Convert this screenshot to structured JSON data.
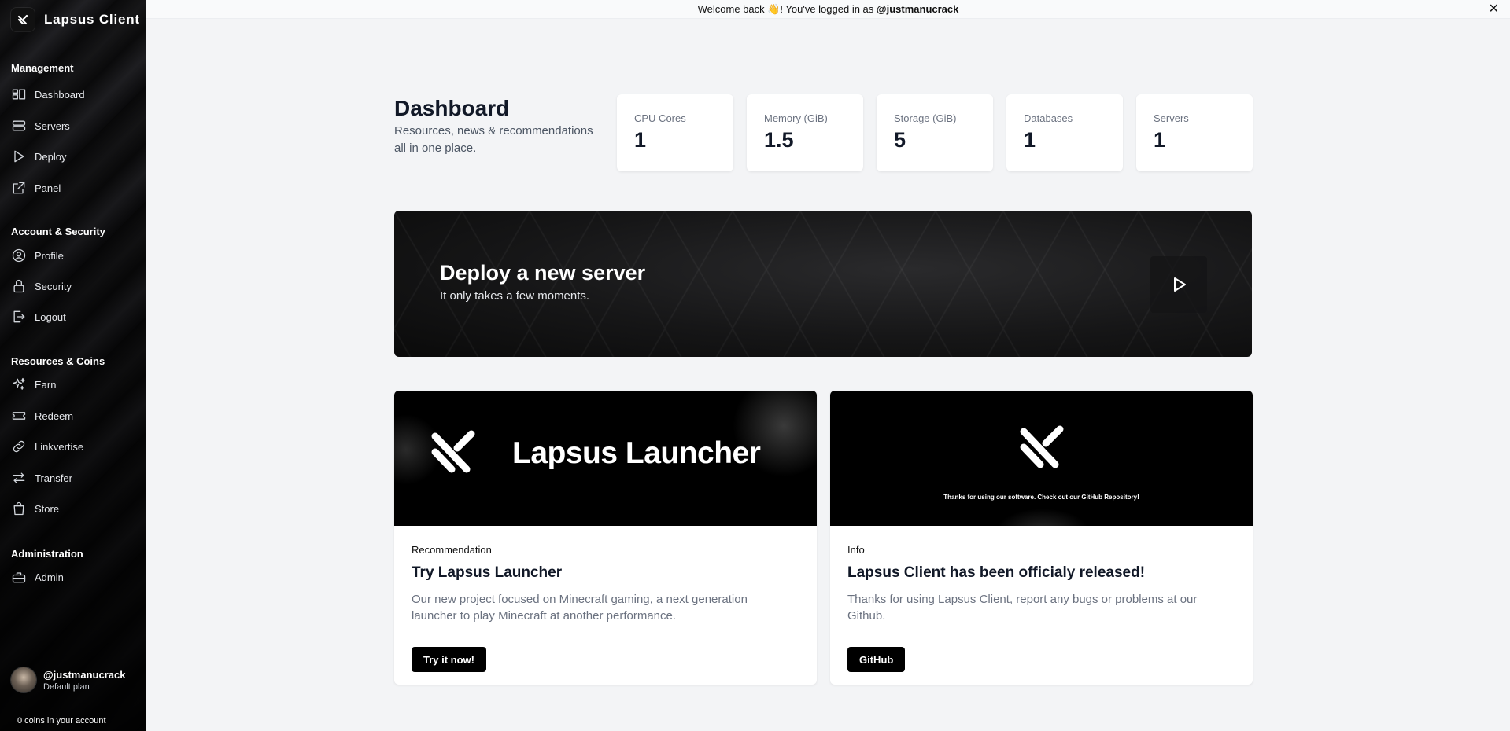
{
  "app": {
    "name": "Lapsus Client"
  },
  "banner": {
    "prefix": "Welcome back 👋! You've logged in as ",
    "username": "@justmanucrack",
    "close": "✕"
  },
  "sidebar": {
    "sections": [
      {
        "title": "Management",
        "items": [
          {
            "label": "Dashboard",
            "icon": "dashboard-icon"
          },
          {
            "label": "Servers",
            "icon": "server-icon"
          },
          {
            "label": "Deploy",
            "icon": "play-icon"
          },
          {
            "label": "Panel",
            "icon": "external-link-icon"
          }
        ]
      },
      {
        "title": "Account & Security",
        "items": [
          {
            "label": "Profile",
            "icon": "user-circle-icon"
          },
          {
            "label": "Security",
            "icon": "lock-icon"
          },
          {
            "label": "Logout",
            "icon": "logout-icon"
          }
        ]
      },
      {
        "title": "Resources & Coins",
        "items": [
          {
            "label": "Earn",
            "icon": "sparkles-icon"
          },
          {
            "label": "Redeem",
            "icon": "ticket-icon"
          },
          {
            "label": "Linkvertise",
            "icon": "link-icon"
          },
          {
            "label": "Transfer",
            "icon": "transfer-icon"
          },
          {
            "label": "Store",
            "icon": "shopping-bag-icon"
          }
        ]
      },
      {
        "title": "Administration",
        "items": [
          {
            "label": "Admin",
            "icon": "toolbox-icon"
          }
        ]
      }
    ],
    "user": {
      "name": "@justmanucrack",
      "plan": "Default plan"
    },
    "coins": "0 coins in your account"
  },
  "dashboard": {
    "title": "Dashboard",
    "subtitle": "Resources, news & recommendations all in one place.",
    "stats": [
      {
        "label": "CPU Cores",
        "value": "1"
      },
      {
        "label": "Memory (GiB)",
        "value": "1.5"
      },
      {
        "label": "Storage (GiB)",
        "value": "5"
      },
      {
        "label": "Databases",
        "value": "1"
      },
      {
        "label": "Servers",
        "value": "1"
      }
    ]
  },
  "deploy": {
    "title": "Deploy a new server",
    "subtitle": "It only takes a few moments."
  },
  "cards": [
    {
      "image_text": "Lapsus Launcher",
      "tag": "Recommendation",
      "title": "Try Lapsus Launcher",
      "description": "Our new project focused on Minecraft gaming, a next generation launcher to play Minecraft at another performance.",
      "button": "Try it now!"
    },
    {
      "image_text": "Thanks for using our software. Check out our GitHub Repository!",
      "tag": "Info",
      "title": "Lapsus Client has been officialy released!",
      "description": "Thanks for using Lapsus Client, report any bugs or problems at our Github.",
      "button": "GitHub"
    }
  ]
}
